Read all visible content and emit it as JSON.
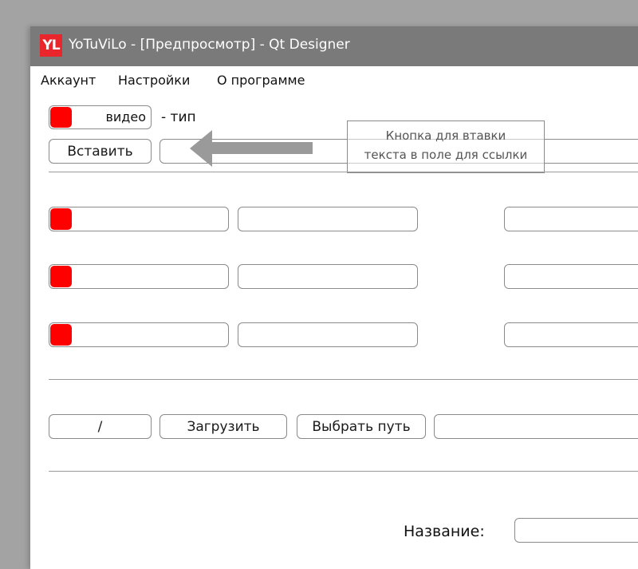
{
  "window": {
    "app_logo_text": "YL",
    "title": "YoTuViLo - [Предпросмотр] - Qt Designer"
  },
  "menu": {
    "items": [
      "Аккаунт",
      "Настройки",
      "О программе"
    ]
  },
  "type_row": {
    "toggle_label": "видео",
    "type_suffix": "- тип"
  },
  "paste_row": {
    "paste_button": "Вставить",
    "link_value": ""
  },
  "tooltip": {
    "line1": "Кнопка для втавки",
    "line2": "текста в поле для ссылки"
  },
  "actions": {
    "counter_label": "/",
    "download_button": "Загрузить",
    "choose_path_button": "Выбрать путь",
    "path_value": ""
  },
  "name_row": {
    "label": "Название:",
    "value": ""
  },
  "colors": {
    "toggle_active": "#ff0000",
    "titlebar": "#7a7a7a",
    "desktop": "#a3a3a3"
  }
}
